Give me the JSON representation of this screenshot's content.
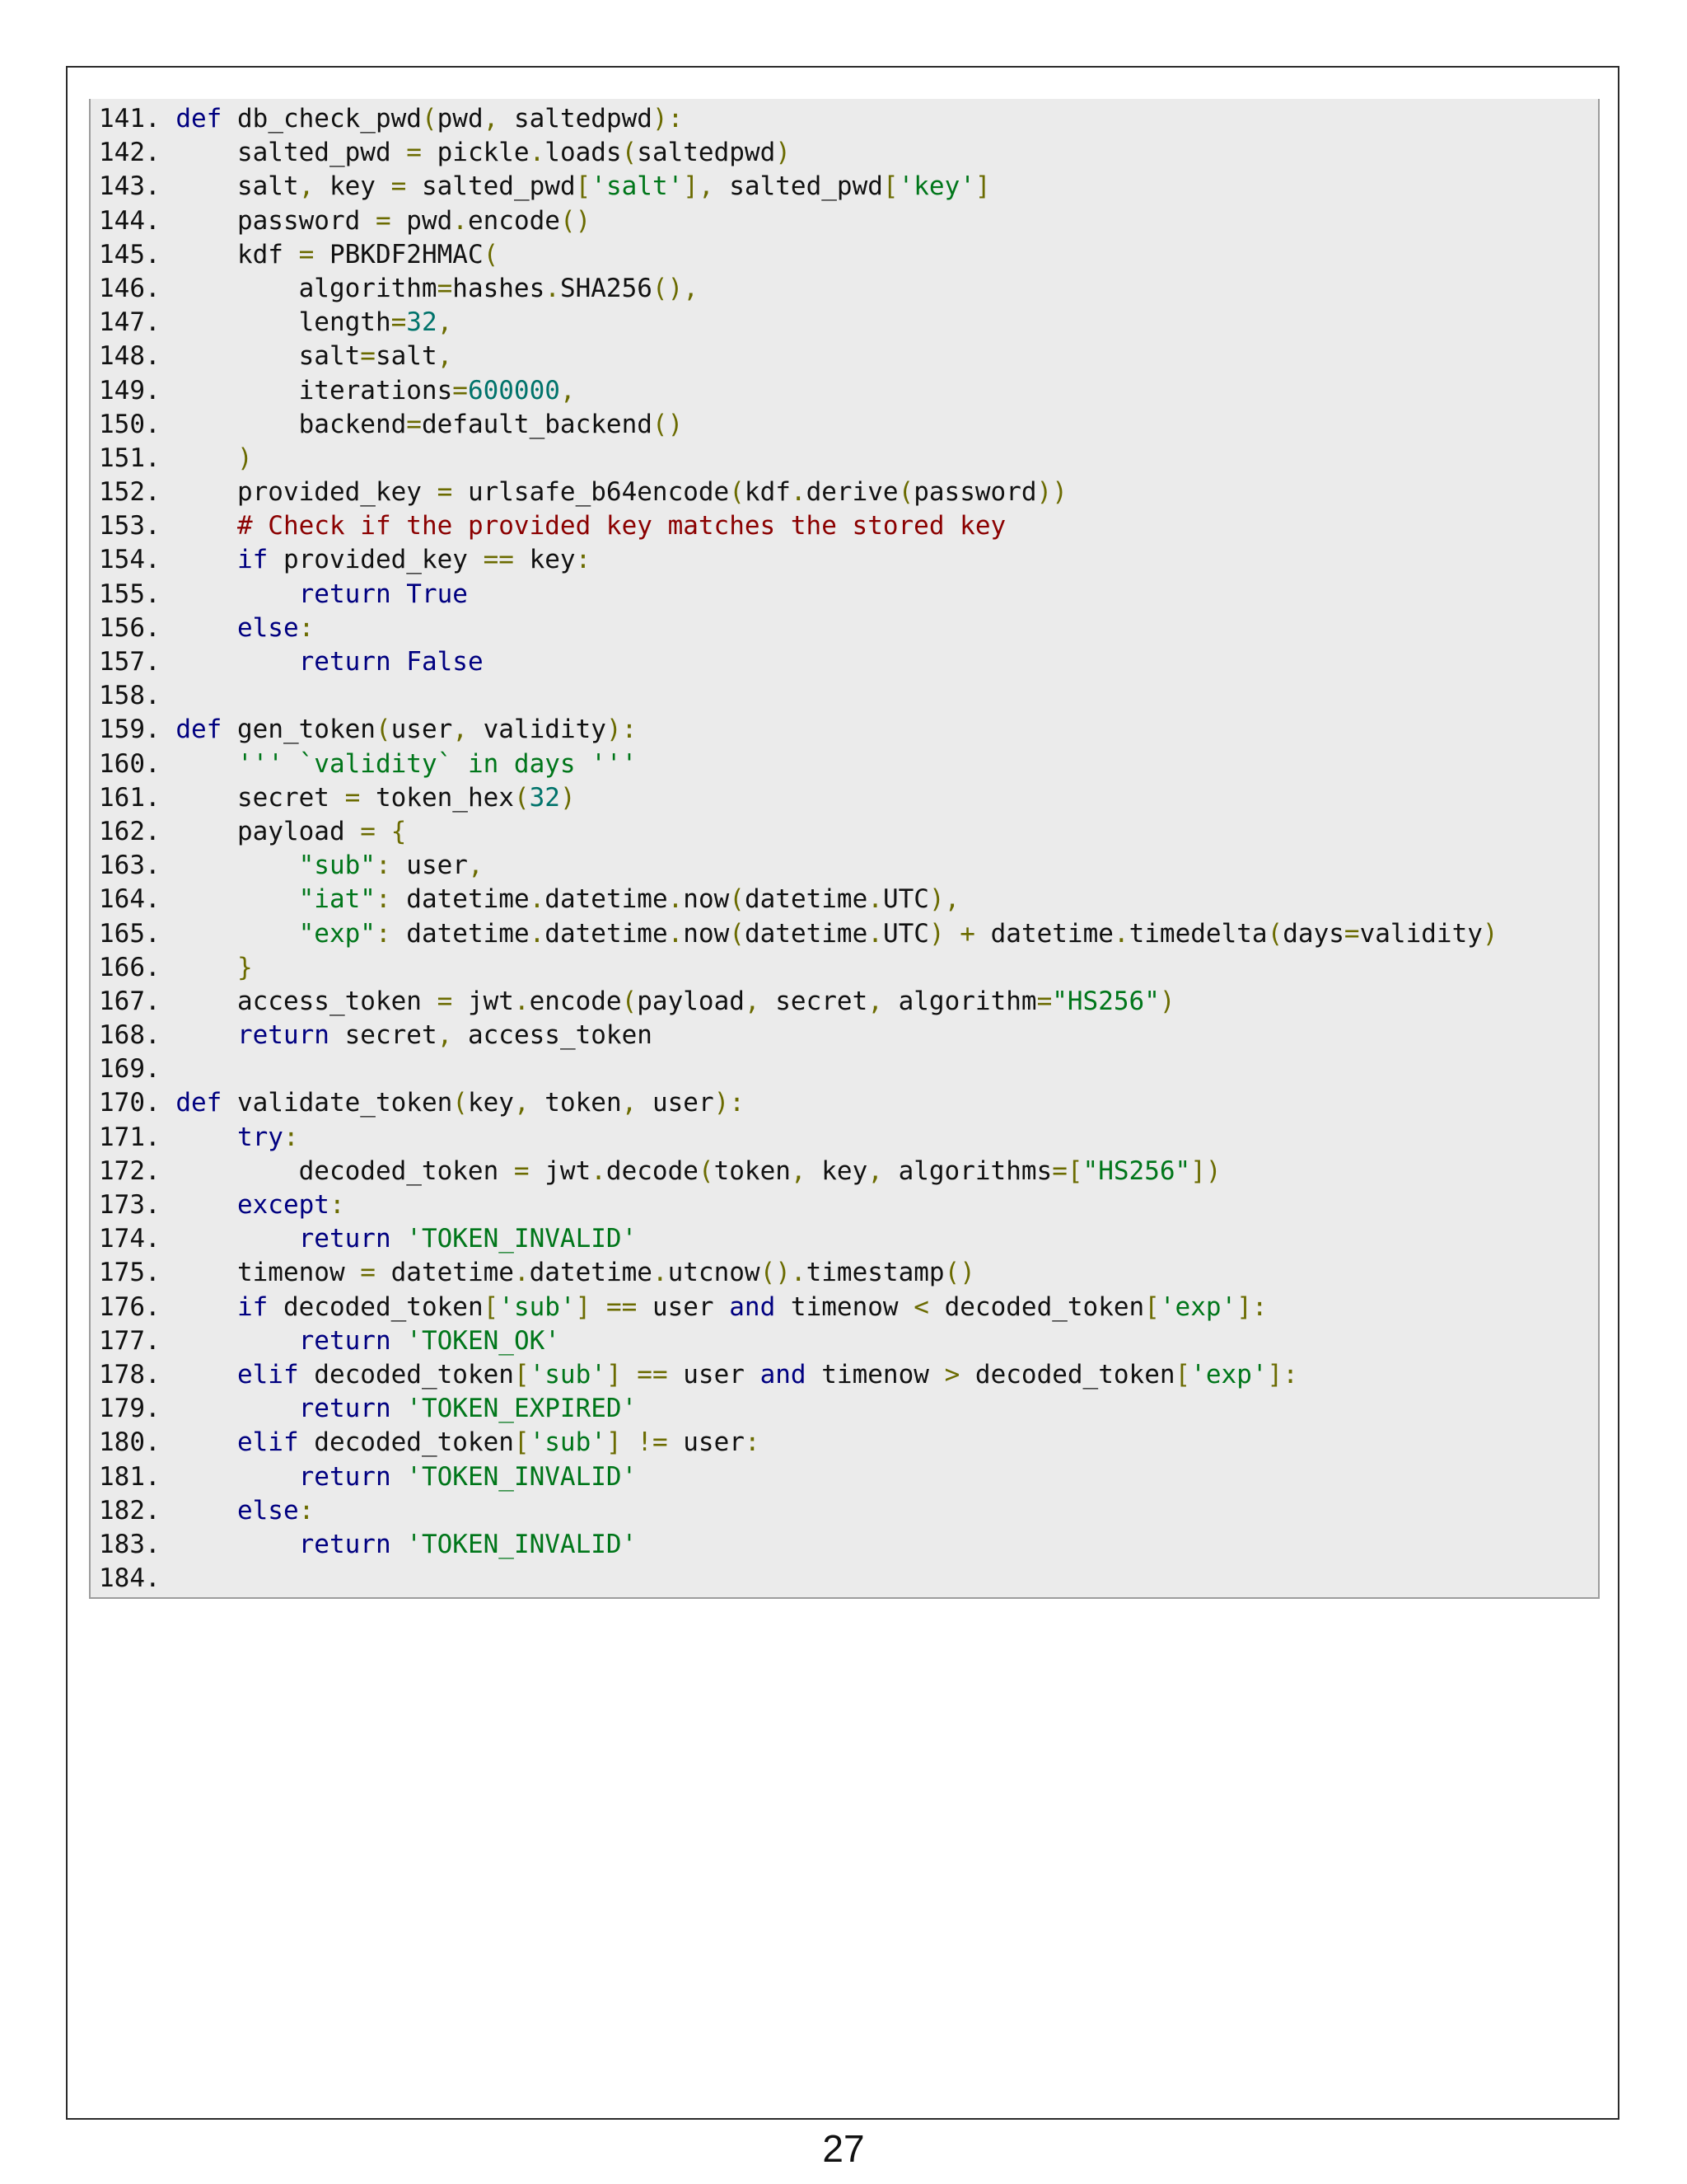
{
  "colors": {
    "keyword": "#000080",
    "punctuation": "#6b6b00",
    "string": "#00761a",
    "number": "#00736b",
    "comment": "#8b0000",
    "plain": "#111111"
  },
  "code_lines": [
    {
      "number": "141.",
      "tokens": [
        {
          "t": " "
        },
        {
          "t": "def",
          "k": "keyword"
        },
        {
          "t": " db_check_pwd"
        },
        {
          "t": "(",
          "k": "punctuation"
        },
        {
          "t": "pwd"
        },
        {
          "t": ",",
          "k": "punctuation"
        },
        {
          "t": " saltedpwd"
        },
        {
          "t": "):",
          "k": "punctuation"
        }
      ]
    },
    {
      "number": "142.",
      "tokens": [
        {
          "t": "     salted_pwd "
        },
        {
          "t": "=",
          "k": "punctuation"
        },
        {
          "t": " pickle"
        },
        {
          "t": ".",
          "k": "punctuation"
        },
        {
          "t": "loads"
        },
        {
          "t": "(",
          "k": "punctuation"
        },
        {
          "t": "saltedpwd"
        },
        {
          "t": ")",
          "k": "punctuation"
        }
      ]
    },
    {
      "number": "143.",
      "tokens": [
        {
          "t": "     salt"
        },
        {
          "t": ",",
          "k": "punctuation"
        },
        {
          "t": " key "
        },
        {
          "t": "=",
          "k": "punctuation"
        },
        {
          "t": " salted_pwd"
        },
        {
          "t": "[",
          "k": "punctuation"
        },
        {
          "t": "'salt'",
          "k": "string"
        },
        {
          "t": "],",
          "k": "punctuation"
        },
        {
          "t": " salted_pwd"
        },
        {
          "t": "[",
          "k": "punctuation"
        },
        {
          "t": "'key'",
          "k": "string"
        },
        {
          "t": "]",
          "k": "punctuation"
        }
      ]
    },
    {
      "number": "144.",
      "tokens": [
        {
          "t": "     password "
        },
        {
          "t": "=",
          "k": "punctuation"
        },
        {
          "t": " pwd"
        },
        {
          "t": ".",
          "k": "punctuation"
        },
        {
          "t": "encode"
        },
        {
          "t": "()",
          "k": "punctuation"
        }
      ]
    },
    {
      "number": "145.",
      "tokens": [
        {
          "t": "     kdf "
        },
        {
          "t": "=",
          "k": "punctuation"
        },
        {
          "t": " PBKDF2HMAC"
        },
        {
          "t": "(",
          "k": "punctuation"
        }
      ]
    },
    {
      "number": "146.",
      "tokens": [
        {
          "t": "         algorithm"
        },
        {
          "t": "=",
          "k": "punctuation"
        },
        {
          "t": "hashes"
        },
        {
          "t": ".",
          "k": "punctuation"
        },
        {
          "t": "SHA256"
        },
        {
          "t": "(),",
          "k": "punctuation"
        }
      ]
    },
    {
      "number": "147.",
      "tokens": [
        {
          "t": "         length"
        },
        {
          "t": "=",
          "k": "punctuation"
        },
        {
          "t": "32",
          "k": "number"
        },
        {
          "t": ",",
          "k": "punctuation"
        }
      ]
    },
    {
      "number": "148.",
      "tokens": [
        {
          "t": "         salt"
        },
        {
          "t": "=",
          "k": "punctuation"
        },
        {
          "t": "salt"
        },
        {
          "t": ",",
          "k": "punctuation"
        }
      ]
    },
    {
      "number": "149.",
      "tokens": [
        {
          "t": "         iterations"
        },
        {
          "t": "=",
          "k": "punctuation"
        },
        {
          "t": "600000",
          "k": "number"
        },
        {
          "t": ",",
          "k": "punctuation"
        }
      ]
    },
    {
      "number": "150.",
      "tokens": [
        {
          "t": "         backend"
        },
        {
          "t": "=",
          "k": "punctuation"
        },
        {
          "t": "default_backend"
        },
        {
          "t": "()",
          "k": "punctuation"
        }
      ]
    },
    {
      "number": "151.",
      "tokens": [
        {
          "t": "     "
        },
        {
          "t": ")",
          "k": "punctuation"
        }
      ]
    },
    {
      "number": "152.",
      "tokens": [
        {
          "t": "     provided_key "
        },
        {
          "t": "=",
          "k": "punctuation"
        },
        {
          "t": " urlsafe_b64encode"
        },
        {
          "t": "(",
          "k": "punctuation"
        },
        {
          "t": "kdf"
        },
        {
          "t": ".",
          "k": "punctuation"
        },
        {
          "t": "derive"
        },
        {
          "t": "(",
          "k": "punctuation"
        },
        {
          "t": "password"
        },
        {
          "t": "))",
          "k": "punctuation"
        }
      ]
    },
    {
      "number": "153.",
      "tokens": [
        {
          "t": "     "
        },
        {
          "t": "# Check if the provided key matches the stored key",
          "k": "comment"
        }
      ]
    },
    {
      "number": "154.",
      "tokens": [
        {
          "t": "     "
        },
        {
          "t": "if",
          "k": "keyword"
        },
        {
          "t": " provided_key "
        },
        {
          "t": "==",
          "k": "punctuation"
        },
        {
          "t": " key"
        },
        {
          "t": ":",
          "k": "punctuation"
        }
      ]
    },
    {
      "number": "155.",
      "tokens": [
        {
          "t": "         "
        },
        {
          "t": "return",
          "k": "keyword"
        },
        {
          "t": " "
        },
        {
          "t": "True",
          "k": "keyword"
        }
      ]
    },
    {
      "number": "156.",
      "tokens": [
        {
          "t": "     "
        },
        {
          "t": "else",
          "k": "keyword"
        },
        {
          "t": ":",
          "k": "punctuation"
        }
      ]
    },
    {
      "number": "157.",
      "tokens": [
        {
          "t": "         "
        },
        {
          "t": "return",
          "k": "keyword"
        },
        {
          "t": " "
        },
        {
          "t": "False",
          "k": "keyword"
        }
      ]
    },
    {
      "number": "158.",
      "tokens": []
    },
    {
      "number": "159.",
      "tokens": [
        {
          "t": " "
        },
        {
          "t": "def",
          "k": "keyword"
        },
        {
          "t": " gen_token"
        },
        {
          "t": "(",
          "k": "punctuation"
        },
        {
          "t": "user"
        },
        {
          "t": ",",
          "k": "punctuation"
        },
        {
          "t": " validity"
        },
        {
          "t": "):",
          "k": "punctuation"
        }
      ]
    },
    {
      "number": "160.",
      "tokens": [
        {
          "t": "     "
        },
        {
          "t": "''' `validity` in days '''",
          "k": "string"
        }
      ]
    },
    {
      "number": "161.",
      "tokens": [
        {
          "t": "     secret "
        },
        {
          "t": "=",
          "k": "punctuation"
        },
        {
          "t": " token_hex"
        },
        {
          "t": "(",
          "k": "punctuation"
        },
        {
          "t": "32",
          "k": "number"
        },
        {
          "t": ")",
          "k": "punctuation"
        }
      ]
    },
    {
      "number": "162.",
      "tokens": [
        {
          "t": "     payload "
        },
        {
          "t": "=",
          "k": "punctuation"
        },
        {
          "t": " "
        },
        {
          "t": "{",
          "k": "punctuation"
        }
      ]
    },
    {
      "number": "163.",
      "tokens": [
        {
          "t": "         "
        },
        {
          "t": "\"sub\"",
          "k": "string"
        },
        {
          "t": ":",
          "k": "punctuation"
        },
        {
          "t": " user"
        },
        {
          "t": ",",
          "k": "punctuation"
        }
      ]
    },
    {
      "number": "164.",
      "tokens": [
        {
          "t": "         "
        },
        {
          "t": "\"iat\"",
          "k": "string"
        },
        {
          "t": ":",
          "k": "punctuation"
        },
        {
          "t": " datetime"
        },
        {
          "t": ".",
          "k": "punctuation"
        },
        {
          "t": "datetime"
        },
        {
          "t": ".",
          "k": "punctuation"
        },
        {
          "t": "now"
        },
        {
          "t": "(",
          "k": "punctuation"
        },
        {
          "t": "datetime"
        },
        {
          "t": ".",
          "k": "punctuation"
        },
        {
          "t": "UTC"
        },
        {
          "t": "),",
          "k": "punctuation"
        }
      ]
    },
    {
      "number": "165.",
      "tokens": [
        {
          "t": "         "
        },
        {
          "t": "\"exp\"",
          "k": "string"
        },
        {
          "t": ":",
          "k": "punctuation"
        },
        {
          "t": " datetime"
        },
        {
          "t": ".",
          "k": "punctuation"
        },
        {
          "t": "datetime"
        },
        {
          "t": ".",
          "k": "punctuation"
        },
        {
          "t": "now"
        },
        {
          "t": "(",
          "k": "punctuation"
        },
        {
          "t": "datetime"
        },
        {
          "t": ".",
          "k": "punctuation"
        },
        {
          "t": "UTC"
        },
        {
          "t": ")",
          "k": "punctuation"
        },
        {
          "t": " "
        },
        {
          "t": "+",
          "k": "punctuation"
        },
        {
          "t": " datetime"
        },
        {
          "t": ".",
          "k": "punctuation"
        },
        {
          "t": "timedelta"
        },
        {
          "t": "(",
          "k": "punctuation"
        },
        {
          "t": "days"
        },
        {
          "t": "=",
          "k": "punctuation"
        },
        {
          "t": "validity"
        },
        {
          "t": ")",
          "k": "punctuation"
        }
      ]
    },
    {
      "number": "166.",
      "tokens": [
        {
          "t": "     "
        },
        {
          "t": "}",
          "k": "punctuation"
        }
      ]
    },
    {
      "number": "167.",
      "tokens": [
        {
          "t": "     access_token "
        },
        {
          "t": "=",
          "k": "punctuation"
        },
        {
          "t": " jwt"
        },
        {
          "t": ".",
          "k": "punctuation"
        },
        {
          "t": "encode"
        },
        {
          "t": "(",
          "k": "punctuation"
        },
        {
          "t": "payload"
        },
        {
          "t": ",",
          "k": "punctuation"
        },
        {
          "t": " secret"
        },
        {
          "t": ",",
          "k": "punctuation"
        },
        {
          "t": " algorithm"
        },
        {
          "t": "=",
          "k": "punctuation"
        },
        {
          "t": "\"HS256\"",
          "k": "string"
        },
        {
          "t": ")",
          "k": "punctuation"
        }
      ]
    },
    {
      "number": "168.",
      "tokens": [
        {
          "t": "     "
        },
        {
          "t": "return",
          "k": "keyword"
        },
        {
          "t": " secret"
        },
        {
          "t": ",",
          "k": "punctuation"
        },
        {
          "t": " access_token"
        }
      ]
    },
    {
      "number": "169.",
      "tokens": []
    },
    {
      "number": "170.",
      "tokens": [
        {
          "t": " "
        },
        {
          "t": "def",
          "k": "keyword"
        },
        {
          "t": " validate_token"
        },
        {
          "t": "(",
          "k": "punctuation"
        },
        {
          "t": "key"
        },
        {
          "t": ",",
          "k": "punctuation"
        },
        {
          "t": " token"
        },
        {
          "t": ",",
          "k": "punctuation"
        },
        {
          "t": " user"
        },
        {
          "t": "):",
          "k": "punctuation"
        }
      ]
    },
    {
      "number": "171.",
      "tokens": [
        {
          "t": "     "
        },
        {
          "t": "try",
          "k": "keyword"
        },
        {
          "t": ":",
          "k": "punctuation"
        }
      ]
    },
    {
      "number": "172.",
      "tokens": [
        {
          "t": "         decoded_token "
        },
        {
          "t": "=",
          "k": "punctuation"
        },
        {
          "t": " jwt"
        },
        {
          "t": ".",
          "k": "punctuation"
        },
        {
          "t": "decode"
        },
        {
          "t": "(",
          "k": "punctuation"
        },
        {
          "t": "token"
        },
        {
          "t": ",",
          "k": "punctuation"
        },
        {
          "t": " key"
        },
        {
          "t": ",",
          "k": "punctuation"
        },
        {
          "t": " algorithms"
        },
        {
          "t": "=[",
          "k": "punctuation"
        },
        {
          "t": "\"HS256\"",
          "k": "string"
        },
        {
          "t": "])",
          "k": "punctuation"
        }
      ]
    },
    {
      "number": "173.",
      "tokens": [
        {
          "t": "     "
        },
        {
          "t": "except",
          "k": "keyword"
        },
        {
          "t": ":",
          "k": "punctuation"
        }
      ]
    },
    {
      "number": "174.",
      "tokens": [
        {
          "t": "         "
        },
        {
          "t": "return",
          "k": "keyword"
        },
        {
          "t": " "
        },
        {
          "t": "'TOKEN_INVALID'",
          "k": "string"
        }
      ]
    },
    {
      "number": "175.",
      "tokens": [
        {
          "t": "     timenow "
        },
        {
          "t": "=",
          "k": "punctuation"
        },
        {
          "t": " datetime"
        },
        {
          "t": ".",
          "k": "punctuation"
        },
        {
          "t": "datetime"
        },
        {
          "t": ".",
          "k": "punctuation"
        },
        {
          "t": "utcnow"
        },
        {
          "t": "().",
          "k": "punctuation"
        },
        {
          "t": "timestamp"
        },
        {
          "t": "()",
          "k": "punctuation"
        }
      ]
    },
    {
      "number": "176.",
      "tokens": [
        {
          "t": "     "
        },
        {
          "t": "if",
          "k": "keyword"
        },
        {
          "t": " decoded_token"
        },
        {
          "t": "[",
          "k": "punctuation"
        },
        {
          "t": "'sub'",
          "k": "string"
        },
        {
          "t": "]",
          "k": "punctuation"
        },
        {
          "t": " "
        },
        {
          "t": "==",
          "k": "punctuation"
        },
        {
          "t": " user "
        },
        {
          "t": "and",
          "k": "keyword"
        },
        {
          "t": " timenow "
        },
        {
          "t": "<",
          "k": "punctuation"
        },
        {
          "t": " decoded_token"
        },
        {
          "t": "[",
          "k": "punctuation"
        },
        {
          "t": "'exp'",
          "k": "string"
        },
        {
          "t": "]:",
          "k": "punctuation"
        }
      ]
    },
    {
      "number": "177.",
      "tokens": [
        {
          "t": "         "
        },
        {
          "t": "return",
          "k": "keyword"
        },
        {
          "t": " "
        },
        {
          "t": "'TOKEN_OK'",
          "k": "string"
        }
      ]
    },
    {
      "number": "178.",
      "tokens": [
        {
          "t": "     "
        },
        {
          "t": "elif",
          "k": "keyword"
        },
        {
          "t": " decoded_token"
        },
        {
          "t": "[",
          "k": "punctuation"
        },
        {
          "t": "'sub'",
          "k": "string"
        },
        {
          "t": "]",
          "k": "punctuation"
        },
        {
          "t": " "
        },
        {
          "t": "==",
          "k": "punctuation"
        },
        {
          "t": " user "
        },
        {
          "t": "and",
          "k": "keyword"
        },
        {
          "t": " timenow "
        },
        {
          "t": ">",
          "k": "punctuation"
        },
        {
          "t": " decoded_token"
        },
        {
          "t": "[",
          "k": "punctuation"
        },
        {
          "t": "'exp'",
          "k": "string"
        },
        {
          "t": "]:",
          "k": "punctuation"
        }
      ]
    },
    {
      "number": "179.",
      "tokens": [
        {
          "t": "         "
        },
        {
          "t": "return",
          "k": "keyword"
        },
        {
          "t": " "
        },
        {
          "t": "'TOKEN_EXPIRED'",
          "k": "string"
        }
      ]
    },
    {
      "number": "180.",
      "tokens": [
        {
          "t": "     "
        },
        {
          "t": "elif",
          "k": "keyword"
        },
        {
          "t": " decoded_token"
        },
        {
          "t": "[",
          "k": "punctuation"
        },
        {
          "t": "'sub'",
          "k": "string"
        },
        {
          "t": "]",
          "k": "punctuation"
        },
        {
          "t": " "
        },
        {
          "t": "!=",
          "k": "punctuation"
        },
        {
          "t": " user"
        },
        {
          "t": ":",
          "k": "punctuation"
        }
      ]
    },
    {
      "number": "181.",
      "tokens": [
        {
          "t": "         "
        },
        {
          "t": "return",
          "k": "keyword"
        },
        {
          "t": " "
        },
        {
          "t": "'TOKEN_INVALID'",
          "k": "string"
        }
      ]
    },
    {
      "number": "182.",
      "tokens": [
        {
          "t": "     "
        },
        {
          "t": "else",
          "k": "keyword"
        },
        {
          "t": ":",
          "k": "punctuation"
        }
      ]
    },
    {
      "number": "183.",
      "tokens": [
        {
          "t": "         "
        },
        {
          "t": "return",
          "k": "keyword"
        },
        {
          "t": " "
        },
        {
          "t": "'TOKEN_INVALID'",
          "k": "string"
        }
      ]
    },
    {
      "number": "184.",
      "tokens": []
    }
  ],
  "page_number": "27"
}
